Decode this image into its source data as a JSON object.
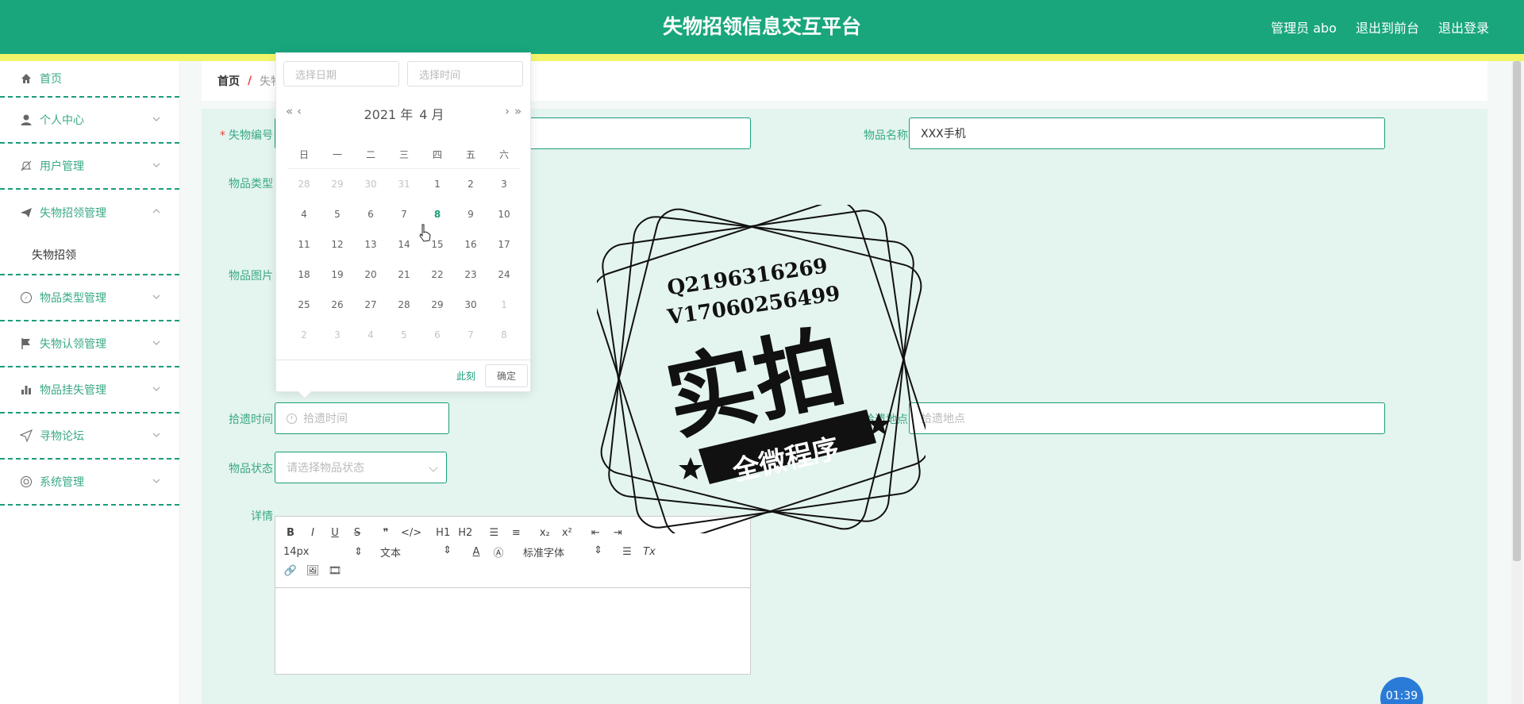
{
  "header": {
    "title": "失物招领信息交互平台",
    "nav": [
      "管理员 abo",
      "退出到前台",
      "退出登录"
    ]
  },
  "sidebar": {
    "items": [
      {
        "label": "首页",
        "icon": "home-icon"
      },
      {
        "label": "个人中心",
        "icon": "user-icon"
      },
      {
        "label": "用户管理",
        "icon": "bell-off-icon"
      },
      {
        "label": "失物招领管理",
        "icon": "send-icon",
        "expanded": true,
        "children": [
          "失物招领"
        ]
      },
      {
        "label": "物品类型管理",
        "icon": "compass-icon"
      },
      {
        "label": "失物认领管理",
        "icon": "flag-icon"
      },
      {
        "label": "物品挂失管理",
        "icon": "chart-icon"
      },
      {
        "label": "寻物论坛",
        "icon": "paper-plane-icon"
      },
      {
        "label": "系统管理",
        "icon": "settings-icon"
      }
    ]
  },
  "breadcrumb": {
    "home": "首页",
    "sep": "/",
    "current": "失物招领"
  },
  "form": {
    "code_label": "失物编号",
    "code_value": "",
    "name_label": "物品名称",
    "name_value": "XXX手机",
    "type_label": "物品类型",
    "image_label": "物品图片",
    "time_label": "拾遗时间",
    "time_placeholder": "拾遗时间",
    "place_label": "拾遗地点",
    "place_placeholder": "拾遗地点",
    "status_label": "物品状态",
    "status_placeholder": "请选择物品状态",
    "detail_label": "详情"
  },
  "editor": {
    "row1": [
      "B",
      "I",
      "U",
      "S",
      "❞",
      "</>",
      "H1",
      "H2",
      "☰",
      "≡",
      "x₂",
      "x²",
      "⇤",
      "⇥"
    ],
    "font_size": "14px",
    "text_style": "文本",
    "font_family": "标准字体",
    "row3": [
      "🔗",
      "🖼",
      "🎞"
    ]
  },
  "datepicker": {
    "date_placeholder": "选择日期",
    "time_placeholder": "选择时间",
    "year": "2021 年",
    "month": "4 月",
    "weekdays": [
      "日",
      "一",
      "二",
      "三",
      "四",
      "五",
      "六"
    ],
    "weeks": [
      [
        {
          "d": "28",
          "dim": true
        },
        {
          "d": "29",
          "dim": true
        },
        {
          "d": "30",
          "dim": true
        },
        {
          "d": "31",
          "dim": true
        },
        {
          "d": "1"
        },
        {
          "d": "2"
        },
        {
          "d": "3"
        }
      ],
      [
        {
          "d": "4"
        },
        {
          "d": "5"
        },
        {
          "d": "6"
        },
        {
          "d": "7"
        },
        {
          "d": "8",
          "today": true
        },
        {
          "d": "9"
        },
        {
          "d": "10"
        }
      ],
      [
        {
          "d": "11"
        },
        {
          "d": "12"
        },
        {
          "d": "13"
        },
        {
          "d": "14"
        },
        {
          "d": "15"
        },
        {
          "d": "16"
        },
        {
          "d": "17"
        }
      ],
      [
        {
          "d": "18"
        },
        {
          "d": "19"
        },
        {
          "d": "20"
        },
        {
          "d": "21"
        },
        {
          "d": "22"
        },
        {
          "d": "23"
        },
        {
          "d": "24"
        }
      ],
      [
        {
          "d": "25"
        },
        {
          "d": "26"
        },
        {
          "d": "27"
        },
        {
          "d": "28"
        },
        {
          "d": "29"
        },
        {
          "d": "30"
        },
        {
          "d": "1",
          "dim": true
        }
      ],
      [
        {
          "d": "2",
          "dim": true
        },
        {
          "d": "3",
          "dim": true
        },
        {
          "d": "4",
          "dim": true
        },
        {
          "d": "5",
          "dim": true
        },
        {
          "d": "6",
          "dim": true
        },
        {
          "d": "7",
          "dim": true
        },
        {
          "d": "8",
          "dim": true
        }
      ]
    ],
    "now_label": "此刻",
    "ok_label": "确定"
  },
  "watermark": {
    "line1": "Q2196316269",
    "line2": "V17060256499",
    "big": "实拍",
    "banner": "全微程序"
  },
  "timer": "01:39",
  "colors": {
    "primary": "#19a67c",
    "accent_strip": "#f2f56b",
    "form_bg": "#e4f4ee",
    "danger": "#e8433a"
  }
}
